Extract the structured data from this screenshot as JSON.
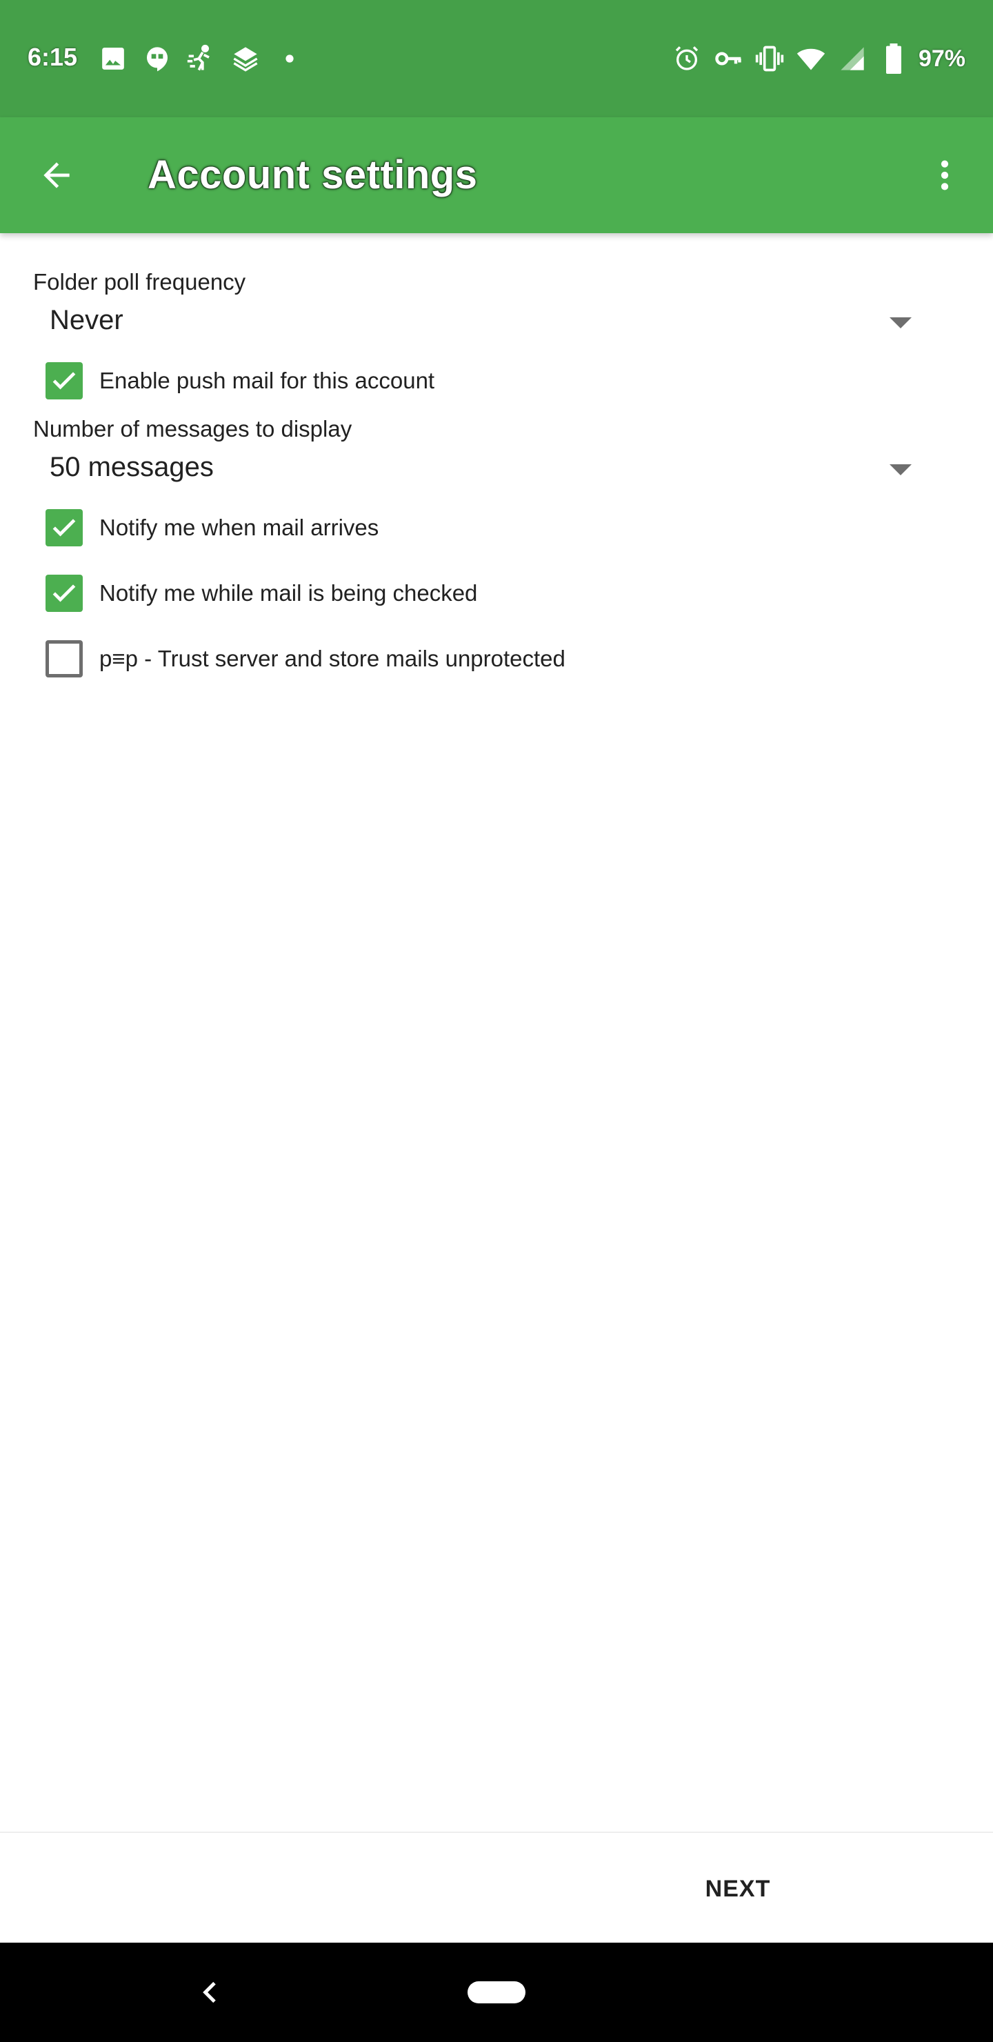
{
  "status_bar": {
    "time": "6:15",
    "battery": "97%",
    "left_icons": [
      "image-icon",
      "hangouts-icon",
      "fitness-icon",
      "layers-icon",
      "dot-icon"
    ],
    "right_icons": [
      "alarm-icon",
      "vpn-key-icon",
      "vibrate-icon",
      "wifi-icon",
      "signal-icon",
      "battery-icon"
    ]
  },
  "app_bar": {
    "title": "Account settings",
    "color": "#4caf50",
    "status_color": "#45a049"
  },
  "settings": {
    "poll_frequency": {
      "label": "Folder poll frequency",
      "value": "Never"
    },
    "push_mail": {
      "label": "Enable push mail for this account",
      "checked": true
    },
    "messages_to_display": {
      "label": "Number of messages to display",
      "value": "50 messages"
    },
    "notify_arrives": {
      "label": "Notify me when mail arrives",
      "checked": true
    },
    "notify_checking": {
      "label": "Notify me while mail is being checked",
      "checked": true
    },
    "pep_trust": {
      "label": "p≡p - Trust server and store mails unprotected",
      "checked": false
    }
  },
  "actions": {
    "next_label": "NEXT"
  }
}
